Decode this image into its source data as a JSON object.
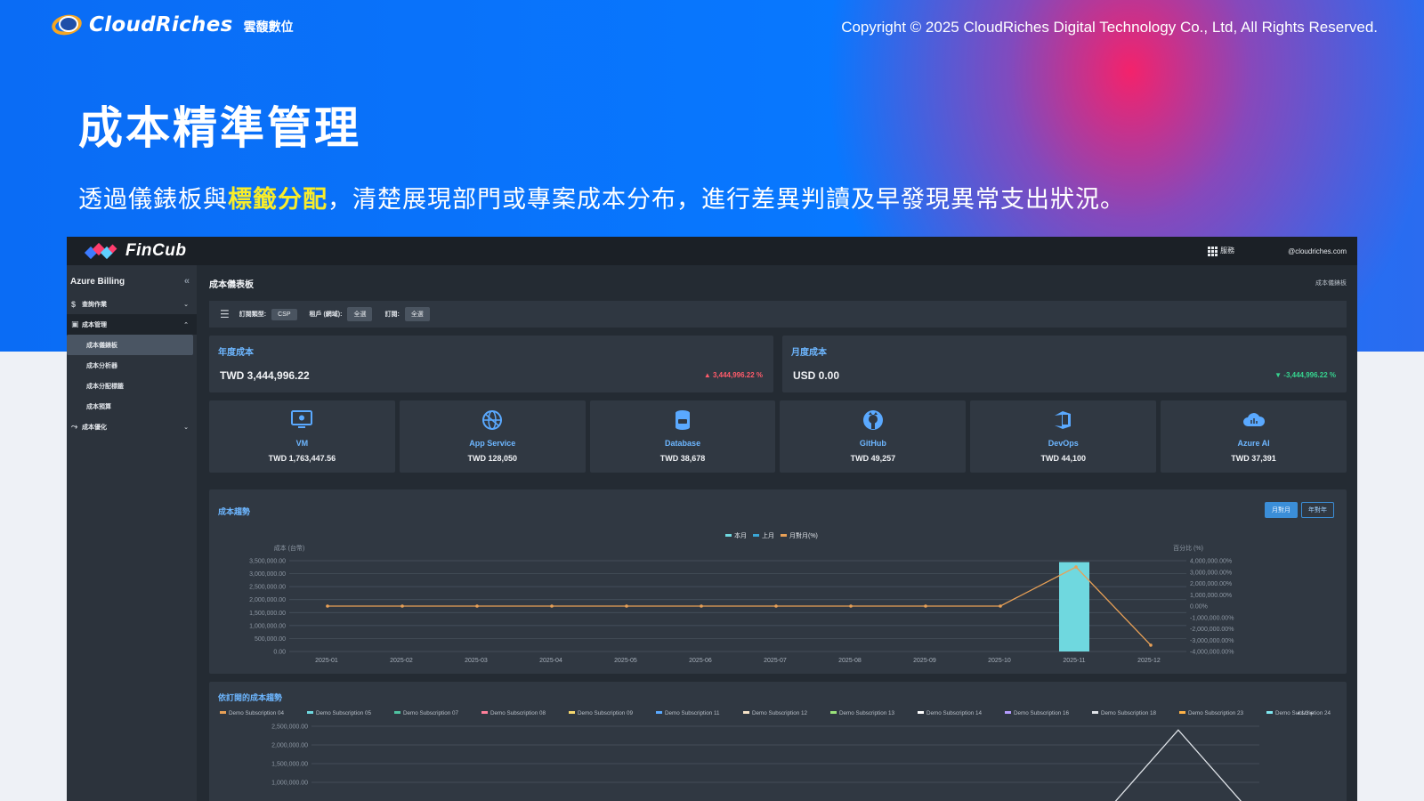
{
  "banner": {
    "brand_name": "CloudRiches",
    "brand_sub": "雲馥數位",
    "copyright": "Copyright © 2025 CloudRiches Digital Technology Co., Ltd, All Rights Reserved.",
    "title": "成本精準管理",
    "desc_before": "透過儀錶板與",
    "desc_highlight": "標籤分配",
    "desc_after": "，清楚展現部門或專案成本分布，進行差異判讀及早發現異常支出狀況。",
    "colors": {
      "blue": "#0878ff",
      "magenta": "#ff1e64",
      "highlight": "#f8ec2a"
    }
  },
  "app": {
    "name": "FinCub",
    "topbar_services": "服務",
    "topbar_user": "@cloudriches.com",
    "sidebar": {
      "header": "Azure Billing",
      "collapse_glyph": "«",
      "items": [
        {
          "label": "查詢作業",
          "icon": "dollar-icon"
        },
        {
          "label": "成本管理",
          "icon": "chart-icon",
          "open": true
        },
        {
          "label": "成本優化",
          "icon": "trend-icon"
        }
      ],
      "sub_items": [
        "成本儀錶板",
        "成本分析器",
        "成本分配標籤",
        "成本預算"
      ]
    },
    "page_title": "成本儀表板",
    "breadcrumb": "成本儀錶板",
    "filters": [
      {
        "label": "訂閱類型:",
        "value": "CSP"
      },
      {
        "label": "租戶 (網域):",
        "value": "全選"
      },
      {
        "label": "訂閱:",
        "value": "全選"
      }
    ],
    "kpis": [
      {
        "label": "年度成本",
        "value": "TWD 3,444,996.22",
        "delta": "▲ 3,444,996.22 %",
        "direction": "up"
      },
      {
        "label": "月度成本",
        "value": "USD 0.00",
        "delta": "▼ -3,444,996.22 %",
        "direction": "down"
      }
    ],
    "services": [
      {
        "name": "VM",
        "value": "TWD 1,763,447.56",
        "icon": "monitor-icon"
      },
      {
        "name": "App Service",
        "value": "TWD 128,050",
        "icon": "globe-icon"
      },
      {
        "name": "Database",
        "value": "TWD 38,678",
        "icon": "database-icon"
      },
      {
        "name": "GitHub",
        "value": "TWD 49,257",
        "icon": "github-icon"
      },
      {
        "name": "DevOps",
        "value": "TWD 44,100",
        "icon": "devops-icon"
      },
      {
        "name": "Azure AI",
        "value": "TWD 37,391",
        "icon": "cloud-ai-icon"
      }
    ],
    "trend": {
      "label": "成本趨勢",
      "toggles": [
        {
          "label": "月對月",
          "active": true
        },
        {
          "label": "年對年",
          "active": false
        }
      ]
    },
    "subscription_trend": {
      "label": "依訂閱的成本趨勢"
    }
  },
  "chart_data": [
    {
      "type": "bar",
      "categories": [
        "2025-01",
        "2025-02",
        "2025-03",
        "2025-04",
        "2025-05",
        "2025-06",
        "2025-07",
        "2025-08",
        "2025-09",
        "2025-10",
        "2025-11",
        "2025-12"
      ],
      "series": [
        {
          "name": "本月",
          "values": [
            0,
            0,
            0,
            0,
            0,
            0,
            0,
            0,
            0,
            0,
            3444996.22,
            0
          ],
          "color": "#6fd8df",
          "type": "bar"
        },
        {
          "name": "上月",
          "values": [
            0,
            0,
            0,
            0,
            0,
            0,
            0,
            0,
            0,
            0,
            0,
            0
          ],
          "color": "#3aa6d6",
          "type": "bar"
        },
        {
          "name": "月對月(%)",
          "values": [
            0,
            0,
            0,
            0,
            0,
            0,
            0,
            0,
            0,
            0,
            3444996.22,
            -3444996.22
          ],
          "color": "#e8a056",
          "type": "line",
          "axis": "right"
        }
      ],
      "ylabel": "成本 (台幣)",
      "ylabel_right": "百分比 (%)",
      "ylim": [
        0,
        3500000
      ],
      "ylim_right": [
        -4000000,
        4000000
      ],
      "yticks": [
        "3,500,000.00",
        "3,000,000.00",
        "2,500,000.00",
        "2,000,000.00",
        "1,500,000.00",
        "1,000,000.00",
        "500,000.00",
        "0.00"
      ],
      "yticks_right": [
        "4,000,000.00%",
        "3,000,000.00%",
        "2,000,000.00%",
        "1,000,000.00%",
        "0.00%",
        "-1,000,000.00%",
        "-2,000,000.00%",
        "-3,000,000.00%",
        "-4,000,000.00%"
      ],
      "grid": true,
      "legend": "top-center"
    },
    {
      "type": "line",
      "legend_entries": [
        {
          "name": "Demo Subscription 04",
          "color": "#e8a056"
        },
        {
          "name": "Demo Subscription 05",
          "color": "#6fd8df"
        },
        {
          "name": "Demo Subscription 07",
          "color": "#4fc3a1"
        },
        {
          "name": "Demo Subscription 08",
          "color": "#ff7f9a"
        },
        {
          "name": "Demo Subscription 09",
          "color": "#f5d76e"
        },
        {
          "name": "Demo Subscription 11",
          "color": "#5aa9ff"
        },
        {
          "name": "Demo Subscription 12",
          "color": "#f4e2c6"
        },
        {
          "name": "Demo Subscription 13",
          "color": "#9be37a"
        },
        {
          "name": "Demo Subscription 14",
          "color": "#ffffff"
        },
        {
          "name": "Demo Subscription 16",
          "color": "#b59cff"
        },
        {
          "name": "Demo Subscription 18",
          "color": "#dfe3e8"
        },
        {
          "name": "Demo Subscription 23",
          "color": "#ffb347"
        },
        {
          "name": "Demo Subscription 24",
          "color": "#7fe7f0"
        },
        {
          "name": "Demo Subscriptic",
          "color": "#4dc2c9"
        }
      ],
      "legend_pager": "1/3",
      "series": [
        {
          "name": "Demo Subscription 14",
          "values": [
            0,
            0,
            0,
            0,
            0,
            0,
            0,
            0,
            0,
            0,
            2400000,
            0
          ],
          "color": "#dfe3e8"
        }
      ],
      "yticks": [
        "2,500,000.00",
        "2,000,000.00",
        "1,500,000.00",
        "1,000,000.00"
      ],
      "ylim": [
        0,
        2500000
      ],
      "grid": true,
      "legend": "top-left"
    }
  ]
}
